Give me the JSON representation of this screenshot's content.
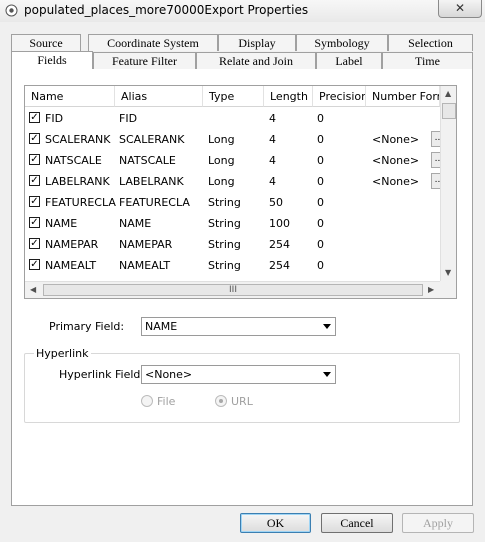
{
  "window": {
    "title": "populated_places_more70000Export  Properties",
    "close_glyph": "✕"
  },
  "tabs_row1": [
    {
      "label": "Source"
    },
    {
      "label": "Coordinate System"
    },
    {
      "label": "Display"
    },
    {
      "label": "Symbology"
    },
    {
      "label": "Selection"
    }
  ],
  "tabs_row2": [
    {
      "label": "Fields",
      "active": true
    },
    {
      "label": "Feature Filter"
    },
    {
      "label": "Relate and Join"
    },
    {
      "label": "Label"
    },
    {
      "label": "Time"
    }
  ],
  "fields_table": {
    "columns": [
      "Name",
      "Alias",
      "Type",
      "Length",
      "Precision",
      "Number Forma"
    ],
    "rows": [
      {
        "checked": true,
        "name": "FID",
        "alias": "FID",
        "type": "",
        "length": "4",
        "precision": "0",
        "format": "",
        "has_button": false
      },
      {
        "checked": true,
        "name": "SCALERANK",
        "alias": "SCALERANK",
        "type": "Long",
        "length": "4",
        "precision": "0",
        "format": "<None>",
        "has_button": true
      },
      {
        "checked": true,
        "name": "NATSCALE",
        "alias": "NATSCALE",
        "type": "Long",
        "length": "4",
        "precision": "0",
        "format": "<None>",
        "has_button": true
      },
      {
        "checked": true,
        "name": "LABELRANK",
        "alias": "LABELRANK",
        "type": "Long",
        "length": "4",
        "precision": "0",
        "format": "<None>",
        "has_button": true
      },
      {
        "checked": true,
        "name": "FEATURECLA",
        "alias": "FEATURECLA",
        "type": "String",
        "length": "50",
        "precision": "0",
        "format": "",
        "has_button": false
      },
      {
        "checked": true,
        "name": "NAME",
        "alias": "NAME",
        "type": "String",
        "length": "100",
        "precision": "0",
        "format": "",
        "has_button": false
      },
      {
        "checked": true,
        "name": "NAMEPAR",
        "alias": "NAMEPAR",
        "type": "String",
        "length": "254",
        "precision": "0",
        "format": "",
        "has_button": false
      },
      {
        "checked": true,
        "name": "NAMEALT",
        "alias": "NAMEALT",
        "type": "String",
        "length": "254",
        "precision": "0",
        "format": "",
        "has_button": false
      }
    ],
    "checkbox_glyph": "✓",
    "ellipsis_label": "..",
    "hscroll_grip": "III"
  },
  "primary_field": {
    "label": "Primary Field:",
    "value": "NAME"
  },
  "hyperlink": {
    "group_label": "Hyperlink",
    "field_label": "Hyperlink Field:",
    "field_value": "<None>",
    "option_file": "File",
    "option_url": "URL",
    "selected": "URL"
  },
  "buttons": {
    "ok": "OK",
    "cancel": "Cancel",
    "apply": "Apply"
  }
}
